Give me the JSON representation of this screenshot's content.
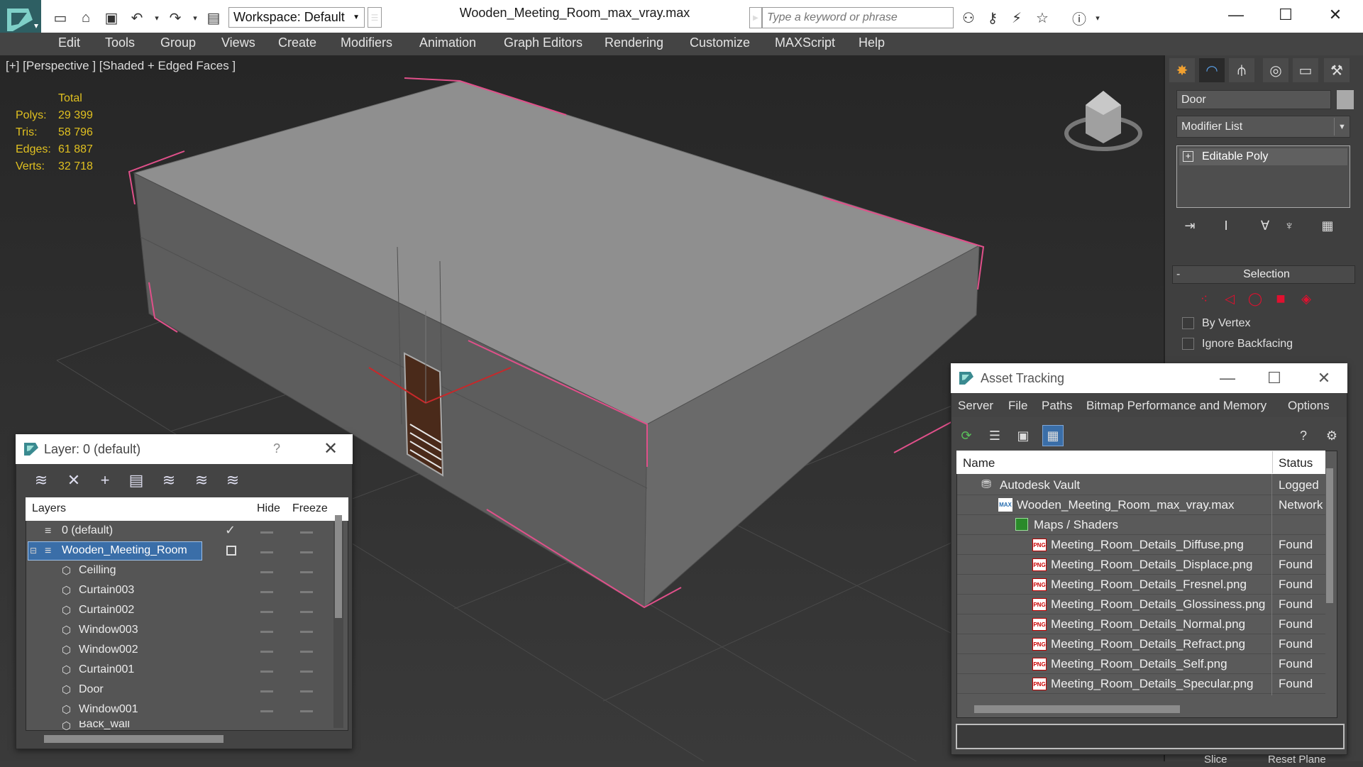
{
  "titlebar": {
    "workspace_label": "Workspace: Default",
    "file_title": "Wooden_Meeting_Room_max_vray.max",
    "search_placeholder": "Type a keyword or phrase"
  },
  "menu": [
    "Edit",
    "Tools",
    "Group",
    "Views",
    "Create",
    "Modifiers",
    "Animation",
    "Graph Editors",
    "Rendering",
    "Customize",
    "MAXScript",
    "Help"
  ],
  "viewport": {
    "label": "[+] [Perspective ] [Shaded + Edged Faces ]",
    "stats_header": "Total",
    "stats": [
      {
        "label": "Polys:",
        "value": "29 399"
      },
      {
        "label": "Tris:",
        "value": "58 796"
      },
      {
        "label": "Edges:",
        "value": "61 887"
      },
      {
        "label": "Verts:",
        "value": "32 718"
      }
    ]
  },
  "command_panel": {
    "object_name": "Door",
    "modifier_list": "Modifier List",
    "stack_item": "Editable Poly",
    "selection_title": "Selection",
    "by_vertex": "By Vertex",
    "ignore_backfacing": "Ignore Backfacing"
  },
  "layer_dialog": {
    "title": "Layer: 0 (default)",
    "help": "?",
    "col_layers": "Layers",
    "col_hide": "Hide",
    "col_freeze": "Freeze",
    "rows": [
      {
        "name": "0 (default)"
      },
      {
        "name": "Wooden_Meeting_Room"
      },
      {
        "name": "Ceilling"
      },
      {
        "name": "Curtain003"
      },
      {
        "name": "Curtain002"
      },
      {
        "name": "Window003"
      },
      {
        "name": "Window002"
      },
      {
        "name": "Curtain001"
      },
      {
        "name": "Door"
      },
      {
        "name": "Window001"
      },
      {
        "name": "Back_wall"
      }
    ]
  },
  "asset_tracking": {
    "title": "Asset Tracking",
    "menu": [
      "Server",
      "File",
      "Paths",
      "Bitmap Performance and Memory",
      "Options"
    ],
    "col_name": "Name",
    "col_status": "Status",
    "rows": [
      {
        "name": "Autodesk Vault",
        "status": "Logged",
        "icon": "vault-icon"
      },
      {
        "name": "Wooden_Meeting_Room_max_vray.max",
        "status": "Network",
        "icon": "max-file-icon"
      },
      {
        "name": "Maps / Shaders",
        "status": "",
        "icon": "maps-icon"
      },
      {
        "name": "Meeting_Room_Details_Diffuse.png",
        "status": "Found",
        "icon": "png-icon"
      },
      {
        "name": "Meeting_Room_Details_Displace.png",
        "status": "Found",
        "icon": "png-icon"
      },
      {
        "name": "Meeting_Room_Details_Fresnel.png",
        "status": "Found",
        "icon": "png-icon"
      },
      {
        "name": "Meeting_Room_Details_Glossiness.png",
        "status": "Found",
        "icon": "png-icon"
      },
      {
        "name": "Meeting_Room_Details_Normal.png",
        "status": "Found",
        "icon": "png-icon"
      },
      {
        "name": "Meeting_Room_Details_Refract.png",
        "status": "Found",
        "icon": "png-icon"
      },
      {
        "name": "Meeting_Room_Details_Self.png",
        "status": "Found",
        "icon": "png-icon"
      },
      {
        "name": "Meeting_Room_Details_Specular.png",
        "status": "Found",
        "icon": "png-icon"
      }
    ]
  },
  "bottom": {
    "slice": "Slice",
    "reset_plane": "Reset Plane"
  },
  "colors": {
    "accent": "#3a6ea8",
    "selection_edge": "#e0508a",
    "stats": "#e0c020",
    "png_icon": "#c00000"
  }
}
